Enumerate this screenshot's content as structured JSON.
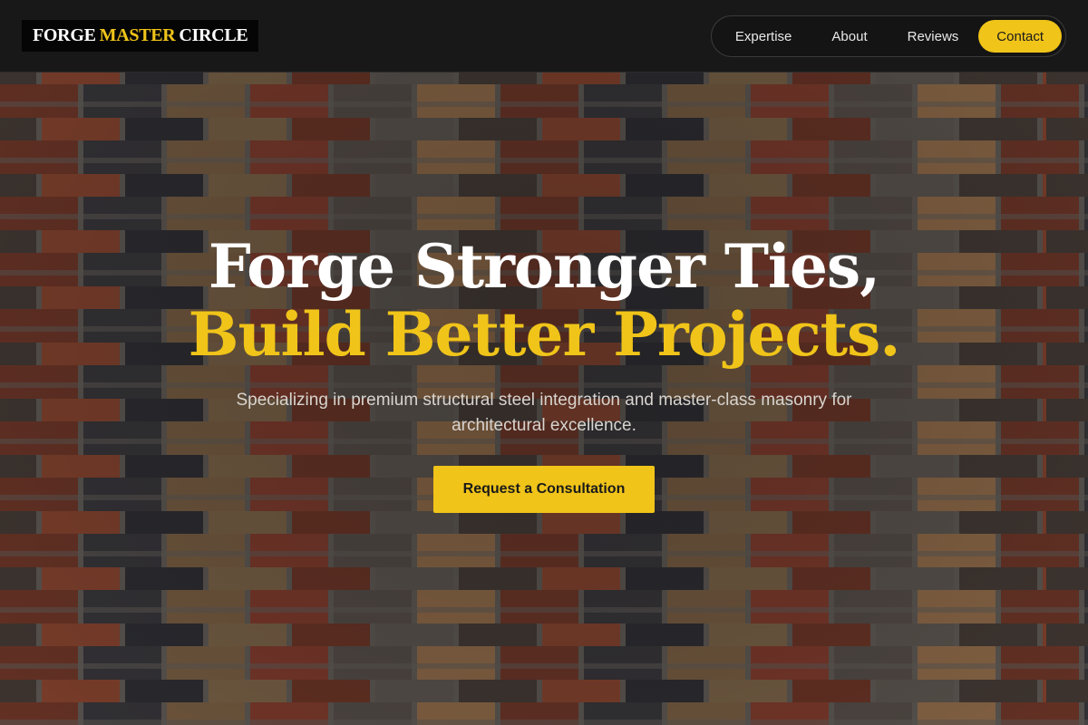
{
  "brand": {
    "logo_part1": "FORGE",
    "logo_accent": "MASTER",
    "logo_part2": "CIRCLE"
  },
  "nav": {
    "items": [
      {
        "label": "Expertise"
      },
      {
        "label": "About"
      },
      {
        "label": "Reviews"
      },
      {
        "label": "Contact"
      }
    ],
    "active": "Contact"
  },
  "hero": {
    "headline_line1": "Forge Stronger Ties,",
    "headline_line2": "Build Better Projects.",
    "subtitle": "Specializing in premium structural steel integration and master-class masonry for architectural excellence.",
    "cta_label": "Request a Consultation"
  },
  "colors": {
    "accent": "#f0c419",
    "header_bg": "#181818",
    "text_light": "#ffffff"
  }
}
